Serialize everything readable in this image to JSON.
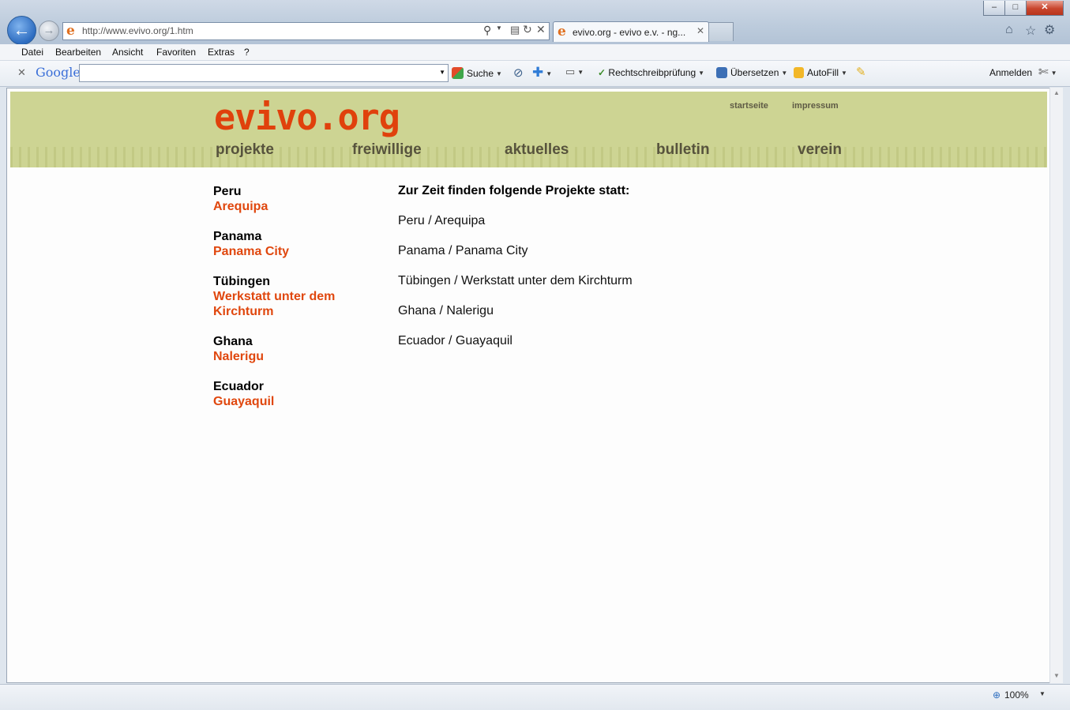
{
  "browser": {
    "address": "http://www.evivo.org/1.htm",
    "tab_title": "evivo.org - evivo e.v. - ng...",
    "menu": [
      "Datei",
      "Bearbeiten",
      "Ansicht",
      "Favoriten",
      "Extras",
      "?"
    ],
    "google_toolbar": {
      "brand": "Google",
      "search_label": "Suche",
      "spellcheck_label": "Rechtschreibprüfung",
      "translate_label": "Übersetzen",
      "autofill_label": "AutoFill",
      "signin_label": "Anmelden"
    },
    "zoom": "100%"
  },
  "site": {
    "logo": "evivo.org",
    "top_links": {
      "home": "startseite",
      "imprint": "impressum"
    },
    "nav": [
      "projekte",
      "freiwillige",
      "aktuelles",
      "bulletin",
      "verein"
    ]
  },
  "sidebar": {
    "items": [
      {
        "region": "Peru",
        "city_line1": "Arequipa",
        "city_line2": ""
      },
      {
        "region": "Panama",
        "city_line1": "Panama City",
        "city_line2": ""
      },
      {
        "region": "Tübingen",
        "city_line1": "Werkstatt unter dem",
        "city_line2": "Kirchturm"
      },
      {
        "region": "Ghana",
        "city_line1": "Nalerigu",
        "city_line2": ""
      },
      {
        "region": "Ecuador",
        "city_line1": "Guayaquil",
        "city_line2": ""
      }
    ]
  },
  "main": {
    "intro": "Zur Zeit finden folgende Projekte statt:",
    "projects": [
      "Peru / Arequipa",
      "Panama / Panama City",
      "Tübingen / Werkstatt unter dem Kirchturm",
      "Ghana / Nalerigu",
      "Ecuador / Guayaquil"
    ]
  }
}
